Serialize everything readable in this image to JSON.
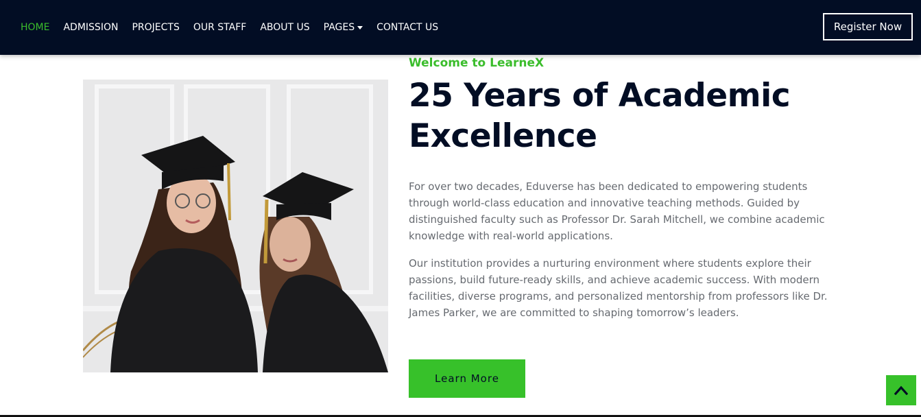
{
  "nav": {
    "items": [
      {
        "label": "HOME",
        "active": true
      },
      {
        "label": "ADMISSION",
        "active": false
      },
      {
        "label": "PROJECTS",
        "active": false
      },
      {
        "label": "OUR STAFF",
        "active": false
      },
      {
        "label": "ABOUT US",
        "active": false
      },
      {
        "label": "PAGES",
        "active": false,
        "dropdown": true
      },
      {
        "label": "CONTACT US",
        "active": false
      }
    ],
    "register_label": "Register Now"
  },
  "hero": {
    "eyebrow": "Welcome to LearneX",
    "title": "25 Years of Academic Excellence",
    "paragraph_1": "For over two decades, Eduverse has been dedicated to empowering students through world-class education and innovative teaching methods. Guided by distinguished faculty such as Professor Dr. Sarah Mitchell, we combine academic knowledge with real-world applications.",
    "paragraph_2": "Our institution provides a nurturing environment where students explore their passions, build future-ready skills, and achieve academic success. With modern facilities, diverse programs, and personalized mentorship from professors like Dr. James Parker, we are committed to shaping tomorrow’s leaders.",
    "button_label": "Learn More",
    "image_icon": "graduates-photo"
  },
  "scroll_top_icon": "chevron-up-icon",
  "colors": {
    "navbar_bg": "#020d24",
    "accent": "#37c12a",
    "heading": "#020d24",
    "body_text": "#666a70"
  }
}
